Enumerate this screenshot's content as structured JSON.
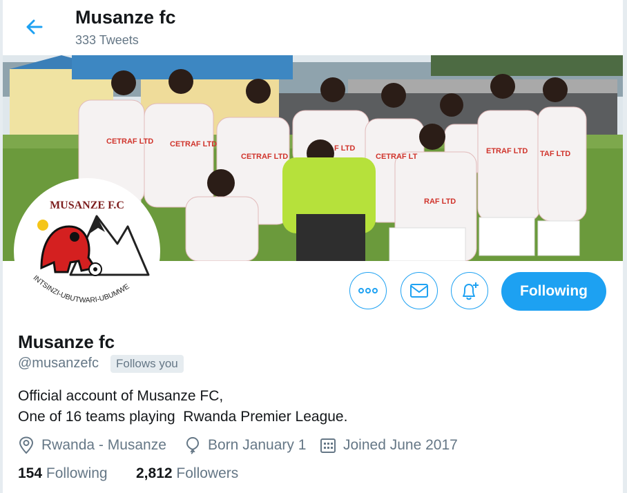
{
  "header": {
    "title": "Musanze fc",
    "tweet_count": "333 Tweets"
  },
  "banner": {
    "jersey_texts": [
      "CETRAF LTD",
      "CETRAF LTD",
      "CETRAF LTD",
      "F LTD",
      "CETRAF LT",
      "RAF LTD",
      "ETRAF LTD",
      "TAF LTD"
    ],
    "colors": {
      "sky": "#e6ecf0",
      "grass": "#6b9a3c",
      "jersey": "#f5f2f2",
      "keeper": "#b6e13b"
    }
  },
  "avatar": {
    "logo_title": "MUSANZE F.C",
    "motto": "INTSINZI-UBUTWARI-UBUMWE"
  },
  "actions": {
    "more_label": "...",
    "message_icon": "envelope-icon",
    "notify_icon": "bell-plus-icon",
    "follow_label": "Following"
  },
  "profile": {
    "name": "Musanze fc",
    "handle": "@musanzefc",
    "follows_you": "Follows you",
    "bio_line1": "Official account of Musanze FC,",
    "bio_line2": "One of 16 teams playing  Rwanda Premier League.",
    "location": "Rwanda - Musanze",
    "born": "Born January 1",
    "joined": "Joined June 2017",
    "following_count": "154",
    "following_label": "Following",
    "followers_count": "2,812",
    "followers_label": "Followers"
  },
  "colors": {
    "accent": "#1da1f2",
    "text": "#14171a",
    "muted": "#657786"
  }
}
